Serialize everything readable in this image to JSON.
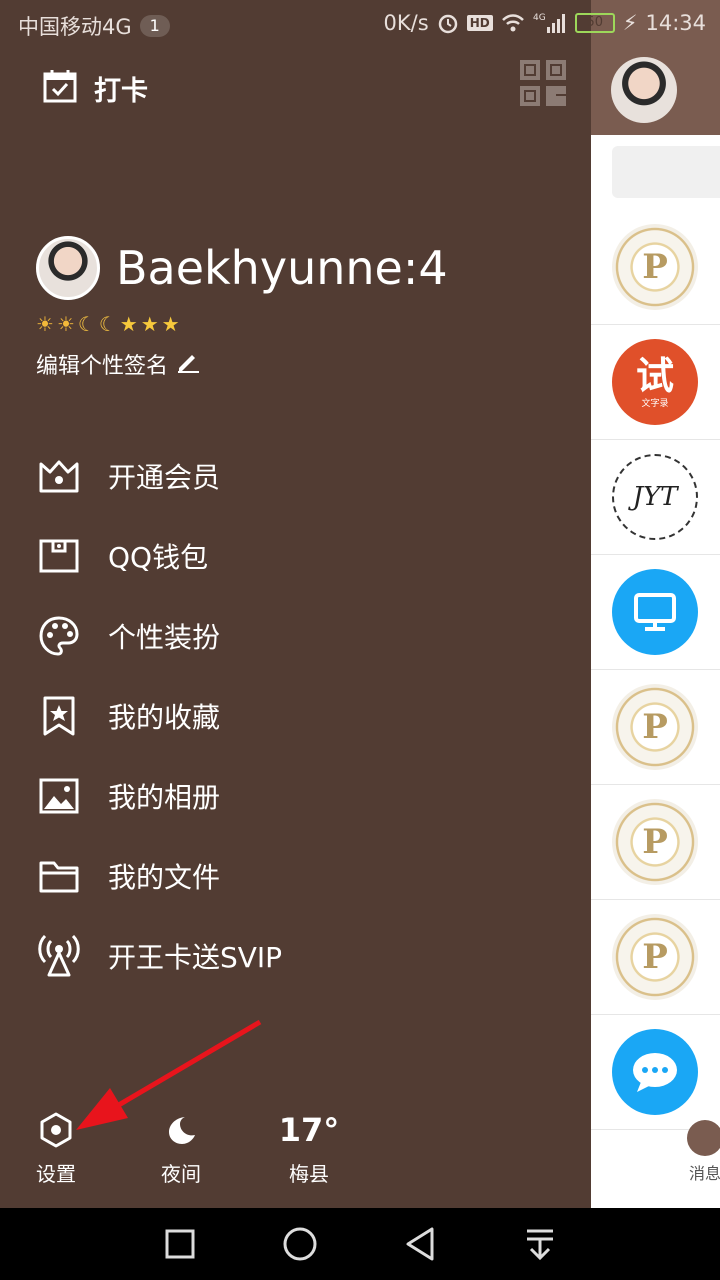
{
  "status_bar": {
    "carrier": "中国移动4G",
    "notif_count": "1",
    "speed": "0K/s",
    "hd": "HD",
    "net": "4G",
    "battery": "50",
    "time": "14:34"
  },
  "drawer": {
    "checkin_label": "打卡",
    "qr_icon": "qrcode-icon",
    "username": "Baekhyunne:4",
    "level_icons": [
      "sun",
      "sun",
      "moon",
      "moon",
      "star",
      "star",
      "star"
    ],
    "signature_label": "编辑个性签名",
    "menu": [
      {
        "label": "开通会员",
        "icon": "crown-icon"
      },
      {
        "label": "QQ钱包",
        "icon": "wallet-icon"
      },
      {
        "label": "个性装扮",
        "icon": "palette-icon"
      },
      {
        "label": "我的收藏",
        "icon": "bookmark-star-icon"
      },
      {
        "label": "我的相册",
        "icon": "photo-icon"
      },
      {
        "label": "我的文件",
        "icon": "folder-icon"
      },
      {
        "label": "开王卡送SVIP",
        "icon": "signal-tower-icon"
      }
    ],
    "bottom": {
      "settings_label": "设置",
      "night_label": "夜间",
      "temperature": "17°",
      "city": "梅县"
    }
  },
  "right_panel": {
    "list_avatars": [
      "P",
      "试",
      "JYT",
      "monitor",
      "P",
      "P",
      "P",
      "chat"
    ],
    "shi_small": "文字录",
    "msg_label": "消息"
  },
  "colors": {
    "drawer_bg": "#523c33",
    "arrow": "#e8141c",
    "blue_icon": "#1aa7f5",
    "orange_icon": "#e0502a"
  }
}
